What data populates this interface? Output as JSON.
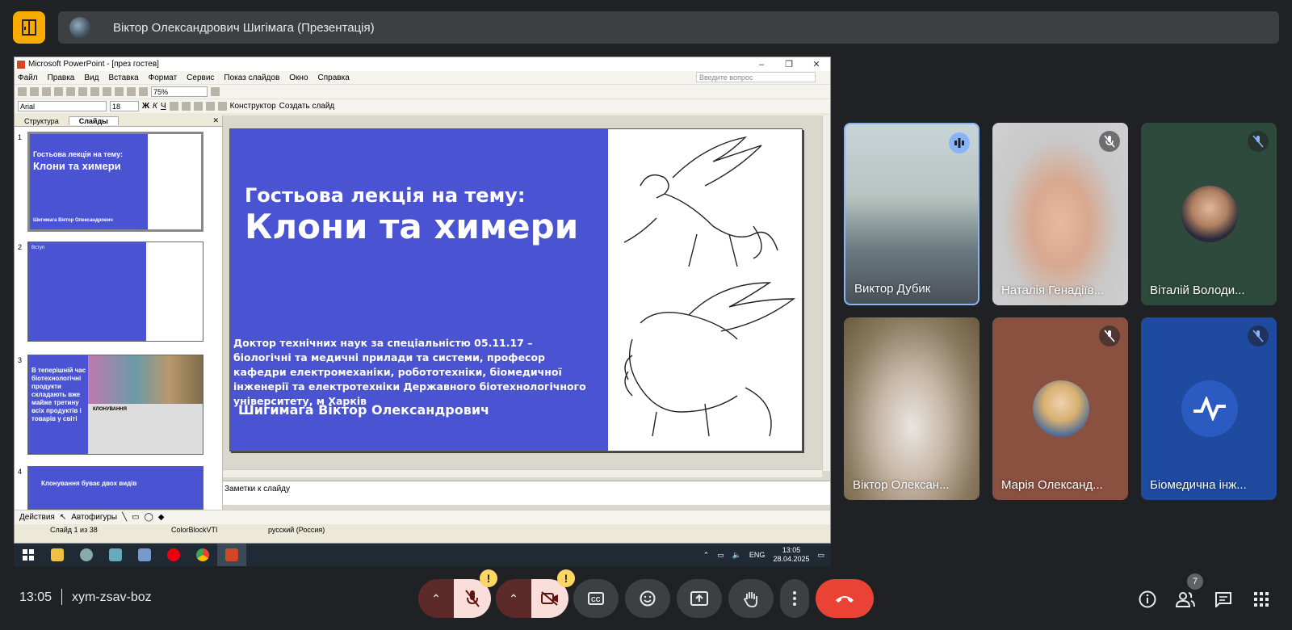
{
  "presenter": {
    "name": "Віктор Олександрович Шигімага (Презентація)"
  },
  "ppt": {
    "title": "Microsoft PowerPoint - [през гостев]",
    "menu": [
      "Файл",
      "Правка",
      "Вид",
      "Вставка",
      "Формат",
      "Сервис",
      "Показ слайдов",
      "Окно",
      "Справка"
    ],
    "ask_placeholder": "Введите вопрос",
    "zoom": "75%",
    "font_name": "Arial",
    "font_size": "18",
    "constructor_label": "Конструктор",
    "new_slide_label": "Создать слайд",
    "tabs": [
      "Структура",
      "Слайды"
    ],
    "thumbs": [
      {
        "num": "1",
        "sub": "Гостьова лекція на тему:",
        "title": "Клони та химери",
        "author": "Шигимага Віктор Олександрович"
      },
      {
        "num": "2",
        "heading": "Вступ"
      },
      {
        "num": "3",
        "text": "В теперішній час біотехнологічні продукти складають вже майже третину всіх продуктів і товарів у світі",
        "label": "КЛОНУВАННЯ"
      },
      {
        "num": "4",
        "text": "Клонування буває двох видів"
      }
    ],
    "slide": {
      "subtitle": "Гостьова лекція на тему:",
      "title": "Клони та химери",
      "description": "Доктор технічних наук за спеціальністю 05.11.17 – біологічні та медичні прилади та системи, професор кафедри електромеханіки, робототехніки, біомедичної інженерії та електротехніки Державного біотехнологічного університету, м Харків",
      "author": "Шигимага Віктор Олександрович"
    },
    "notes_placeholder": "Заметки к слайду",
    "draw_toolbar": {
      "actions": "Действия",
      "autoshapes": "Автофигуры"
    },
    "status": {
      "slide": "Слайд 1 из 38",
      "design": "ColorBlockVTI",
      "lang": "русский (Россия)"
    }
  },
  "taskbar": {
    "lang": "ENG",
    "time": "13:05",
    "date": "28.04.2025"
  },
  "participants": [
    {
      "name": "Виктор Дубик",
      "state": "speaking"
    },
    {
      "name": "Наталія Генадіїв...",
      "state": "muted"
    },
    {
      "name": "Віталій Володи...",
      "state": "muted"
    },
    {
      "name": "Віктор Олексан...",
      "state": ""
    },
    {
      "name": "Марія Олександ...",
      "state": "muted"
    },
    {
      "name": "Біомедична інж...",
      "state": "muted"
    }
  ],
  "meeting": {
    "time": "13:05",
    "code": "xym-zsav-boz",
    "people_count": "7"
  },
  "colors": {
    "accent_red": "#ea4335",
    "warn": "#fdd663",
    "tile_bg": "#3c4043",
    "slide_blue": "#4a53d1"
  }
}
